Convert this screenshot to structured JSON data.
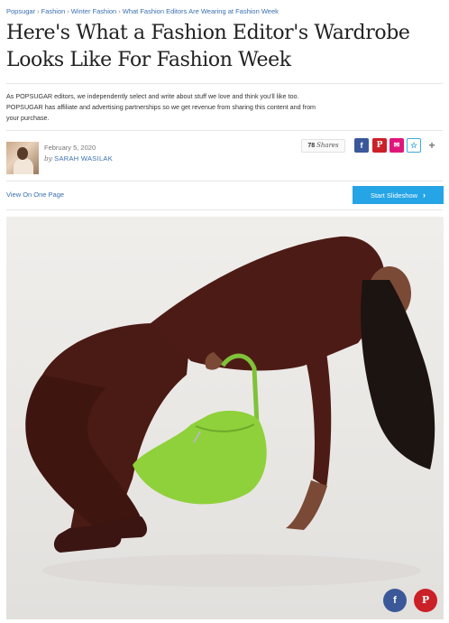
{
  "breadcrumb": {
    "items": [
      "Popsugar",
      "Fashion",
      "Winter Fashion",
      "What Fashion Editors Are Wearing at Fashion Week"
    ],
    "separator": "›"
  },
  "article": {
    "title": "Here's What a Fashion Editor's Wardrobe Looks Like For Fashion Week",
    "disclosure": "As POPSUGAR editors, we independently select and write about stuff we love and think you'll like too. POPSUGAR has affiliate and advertising partnerships so we get revenue from sharing this content and from your purchase.",
    "date": "February 5, 2020",
    "by": "by",
    "author": "SARAH WASILAK"
  },
  "share": {
    "count": "78",
    "count_label": "Shares",
    "facebook_glyph": "f",
    "pinterest_glyph": "P",
    "mail_glyph": "✉",
    "favorite_glyph": "☆",
    "more_glyph": "+"
  },
  "nav": {
    "view_one_page": "View On One Page",
    "start_slideshow": "Start Slideshow",
    "chevron": "›"
  },
  "hero": {
    "icon": "fashion-photo"
  },
  "floating_share": {
    "facebook_glyph": "f",
    "pinterest_glyph": "P"
  },
  "colors": {
    "link": "#3a6fb0",
    "accent_button": "#25a4e6",
    "facebook": "#3b5998",
    "pinterest": "#cb2027",
    "mail": "#e0177a"
  }
}
